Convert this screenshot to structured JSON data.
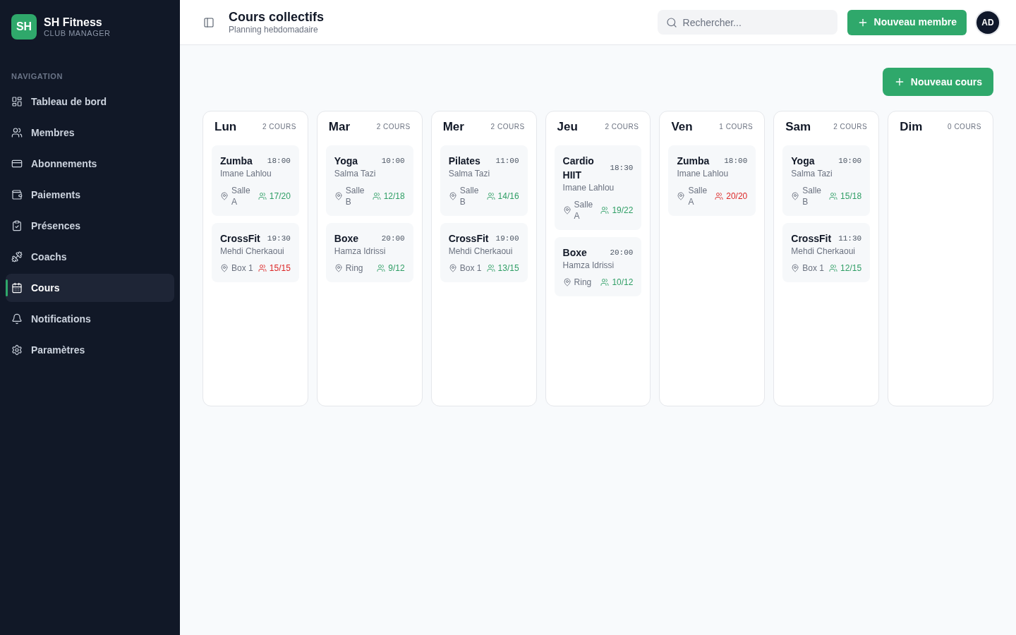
{
  "sidebar": {
    "logo": {
      "initials": "SH",
      "name": "SH Fitness",
      "tagline": "CLUB MANAGER"
    },
    "section_label": "NAVIGATION",
    "items": [
      {
        "label": "Tableau de bord",
        "selected": false
      },
      {
        "label": "Membres",
        "selected": false
      },
      {
        "label": "Abonnements",
        "selected": false
      },
      {
        "label": "Paiements",
        "selected": false
      },
      {
        "label": "Présences",
        "selected": false
      },
      {
        "label": "Coachs",
        "selected": false
      },
      {
        "label": "Cours",
        "selected": true
      },
      {
        "label": "Notifications",
        "selected": false
      },
      {
        "label": "Paramètres",
        "selected": false
      }
    ]
  },
  "header": {
    "title": "Cours collectifs",
    "subtitle": "Planning hebdomadaire",
    "search": {
      "placeholder": "Rechercher..."
    },
    "new_member_button": "Nouveau membre",
    "avatar": "AD"
  },
  "main": {
    "new_course_button": "Nouveau cours",
    "days": [
      {
        "name": "Lun",
        "count": "2 COURS",
        "courses": [
          {
            "name": "Zumba",
            "time": "18:00",
            "coach": "Imane Lahlou",
            "room": "Salle A",
            "capacity": "17/20",
            "full": false
          },
          {
            "name": "CrossFit",
            "time": "19:30",
            "coach": "Mehdi Cherkaoui",
            "room": "Box 1",
            "capacity": "15/15",
            "full": true
          }
        ]
      },
      {
        "name": "Mar",
        "count": "2 COURS",
        "courses": [
          {
            "name": "Yoga",
            "time": "10:00",
            "coach": "Salma Tazi",
            "room": "Salle B",
            "capacity": "12/18",
            "full": false
          },
          {
            "name": "Boxe",
            "time": "20:00",
            "coach": "Hamza Idrissi",
            "room": "Ring",
            "capacity": "9/12",
            "full": false
          }
        ]
      },
      {
        "name": "Mer",
        "count": "2 COURS",
        "courses": [
          {
            "name": "Pilates",
            "time": "11:00",
            "coach": "Salma Tazi",
            "room": "Salle B",
            "capacity": "14/16",
            "full": false
          },
          {
            "name": "CrossFit",
            "time": "19:00",
            "coach": "Mehdi Cherkaoui",
            "room": "Box 1",
            "capacity": "13/15",
            "full": false
          }
        ]
      },
      {
        "name": "Jeu",
        "count": "2 COURS",
        "courses": [
          {
            "name": "Cardio HIIT",
            "time": "18:30",
            "coach": "Imane Lahlou",
            "room": "Salle A",
            "capacity": "19/22",
            "full": false
          },
          {
            "name": "Boxe",
            "time": "20:00",
            "coach": "Hamza Idrissi",
            "room": "Ring",
            "capacity": "10/12",
            "full": false
          }
        ]
      },
      {
        "name": "Ven",
        "count": "1 COURS",
        "courses": [
          {
            "name": "Zumba",
            "time": "18:00",
            "coach": "Imane Lahlou",
            "room": "Salle A",
            "capacity": "20/20",
            "full": true
          }
        ]
      },
      {
        "name": "Sam",
        "count": "2 COURS",
        "courses": [
          {
            "name": "Yoga",
            "time": "10:00",
            "coach": "Salma Tazi",
            "room": "Salle B",
            "capacity": "15/18",
            "full": false
          },
          {
            "name": "CrossFit",
            "time": "11:30",
            "coach": "Mehdi Cherkaoui",
            "room": "Box 1",
            "capacity": "12/15",
            "full": false
          }
        ]
      },
      {
        "name": "Dim",
        "count": "0 COURS"
      }
    ]
  }
}
